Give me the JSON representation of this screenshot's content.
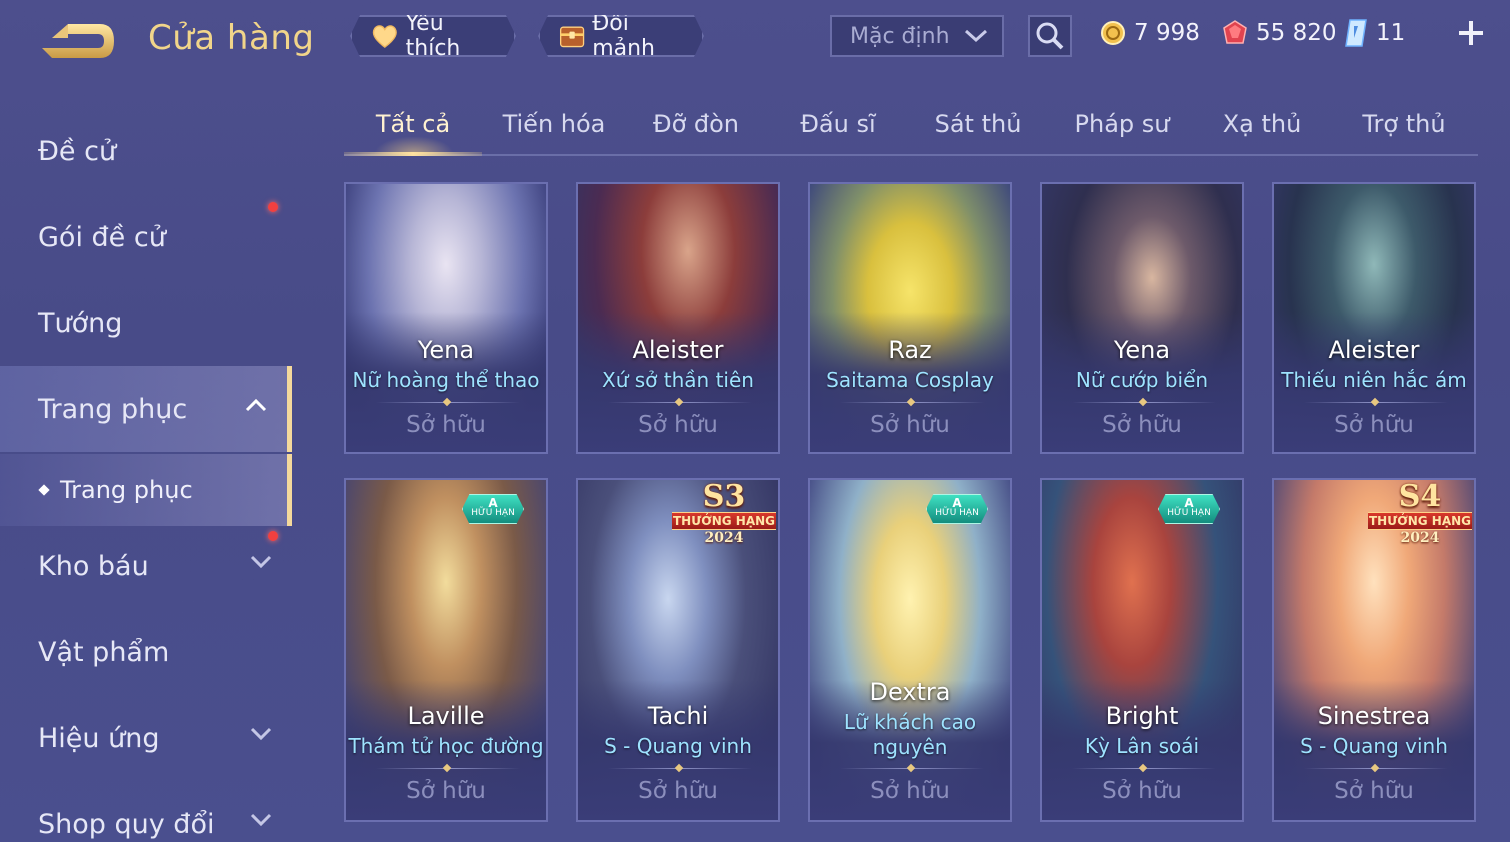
{
  "header": {
    "title": "Cửa hàng",
    "favorites_label": "Yêu thích",
    "exchange_label": "Đổi mảnh",
    "sort_value": "Mặc định",
    "gold": "7 998",
    "rubies": "55 820",
    "vouchers": "11"
  },
  "sidebar": {
    "items": [
      {
        "label": "Đề cử"
      },
      {
        "label": "Gói đề cử"
      },
      {
        "label": "Tướng"
      },
      {
        "label": "Trang phục"
      },
      {
        "label": "Kho báu"
      },
      {
        "label": "Vật phẩm"
      },
      {
        "label": "Hiệu ứng"
      },
      {
        "label": "Shop quy đổi"
      }
    ],
    "sub_item": "Trang phục"
  },
  "tabs": [
    "Tất cả",
    "Tiến hóa",
    "Đỡ đòn",
    "Đấu sĩ",
    "Sát thủ",
    "Pháp sư",
    "Xạ thủ",
    "Trợ thủ"
  ],
  "owned_label": "Sở hữu",
  "cards": [
    {
      "hero": "Yena",
      "skin": "Nữ hoàng thể thao"
    },
    {
      "hero": "Aleister",
      "skin": "Xứ sở thần tiên"
    },
    {
      "hero": "Raz",
      "skin": "Saitama Cosplay"
    },
    {
      "hero": "Yena",
      "skin": "Nữ cướp biển"
    },
    {
      "hero": "Aleister",
      "skin": "Thiếu niên hắc ám"
    },
    {
      "hero": "Laville",
      "skin": "Thám tử học đường",
      "badge_tier": "A",
      "badge_text": "HỮU HẠN"
    },
    {
      "hero": "Tachi",
      "skin": "S - Quang vinh",
      "badge_season": "S3",
      "badge_text": "THƯỞNG HẠNG",
      "badge_year": "2024"
    },
    {
      "hero": "Dextra",
      "skin_line1": "Lữ khách cao",
      "skin_line2": "nguyên",
      "badge_tier": "A",
      "badge_text": "HỮU HẠN"
    },
    {
      "hero": "Bright",
      "skin": "Kỳ Lân soái",
      "badge_tier": "A",
      "badge_text": "HỮU HẠN"
    },
    {
      "hero": "Sinestrea",
      "skin": "S - Quang vinh",
      "badge_season": "S4",
      "badge_text": "THƯỞNG HẠNG",
      "badge_year": "2024"
    }
  ],
  "colors": {
    "background": "#4b4e8c",
    "title_gold": "#f1d58a",
    "skin_name": "#9ee3ff",
    "notification": "#f2403f"
  }
}
